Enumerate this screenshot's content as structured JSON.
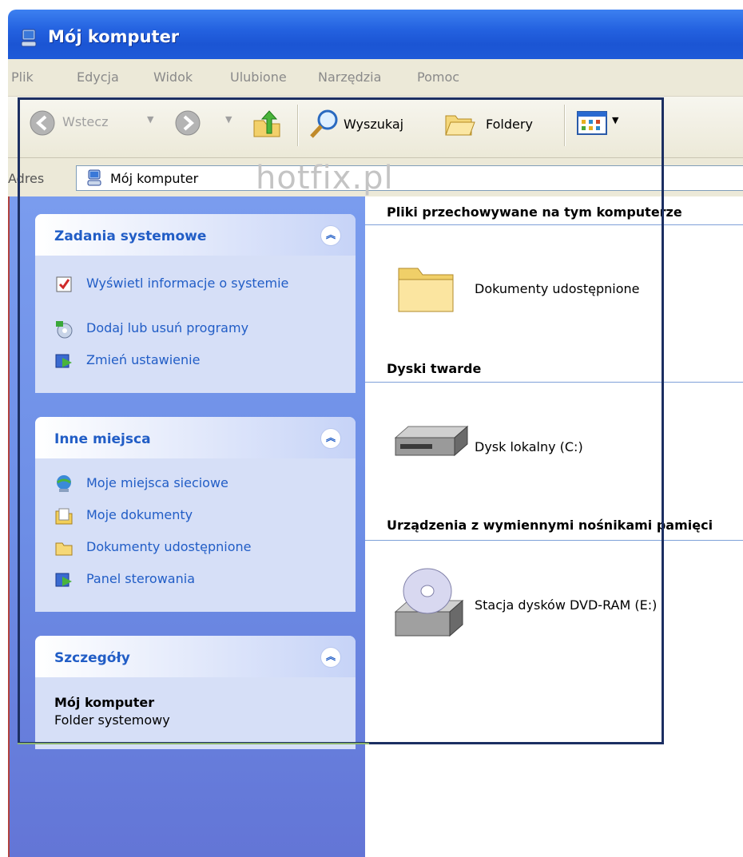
{
  "window": {
    "title": "Mój komputer",
    "icon": "my-computer-icon"
  },
  "menu": [
    "Plik",
    "Edycja",
    "Widok",
    "Ulubione",
    "Narzędzia",
    "Pomoc"
  ],
  "toolbar": {
    "back_label": "Wstecz",
    "search_label": "Wyszukaj",
    "folders_label": "Foldery"
  },
  "address": {
    "label": "Adres",
    "value": "Mój komputer"
  },
  "watermark": "hotfix.pl",
  "left_pane": {
    "system_tasks": {
      "title": "Zadania systemowe",
      "items": [
        {
          "label": "Wyświetl informacje o systemie",
          "icon": "system-info-icon"
        },
        {
          "label": "Dodaj lub usuń programy",
          "icon": "add-remove-programs-icon"
        },
        {
          "label": "Zmień ustawienie",
          "icon": "control-panel-icon"
        }
      ]
    },
    "other_places": {
      "title": "Inne miejsca",
      "items": [
        {
          "label": "Moje miejsca sieciowe",
          "icon": "network-places-icon"
        },
        {
          "label": "Moje dokumenty",
          "icon": "my-documents-icon"
        },
        {
          "label": "Dokumenty udostępnione",
          "icon": "folder-icon"
        },
        {
          "label": "Panel sterowania",
          "icon": "control-panel-icon"
        }
      ]
    },
    "details": {
      "title": "Szczegóły",
      "name": "Mój komputer",
      "type": "Folder systemowy"
    }
  },
  "right_pane": {
    "groups": [
      {
        "title": "Pliki przechowywane na tym komputerze",
        "items": [
          {
            "label": "Dokumenty udostępnione",
            "icon": "shared-folder-icon"
          }
        ]
      },
      {
        "title": "Dyski twarde",
        "items": [
          {
            "label": "Dysk lokalny (C:)",
            "icon": "hard-drive-icon"
          }
        ]
      },
      {
        "title": "Urządzenia z wymiennymi nośnikami pamięci",
        "items": [
          {
            "label": "Stacja dysków DVD-RAM (E:)",
            "icon": "dvd-drive-icon"
          }
        ]
      }
    ]
  },
  "colors": {
    "titlebar": "#2462e0",
    "taskpane": "#6d8ee6",
    "link": "#215dc6"
  }
}
